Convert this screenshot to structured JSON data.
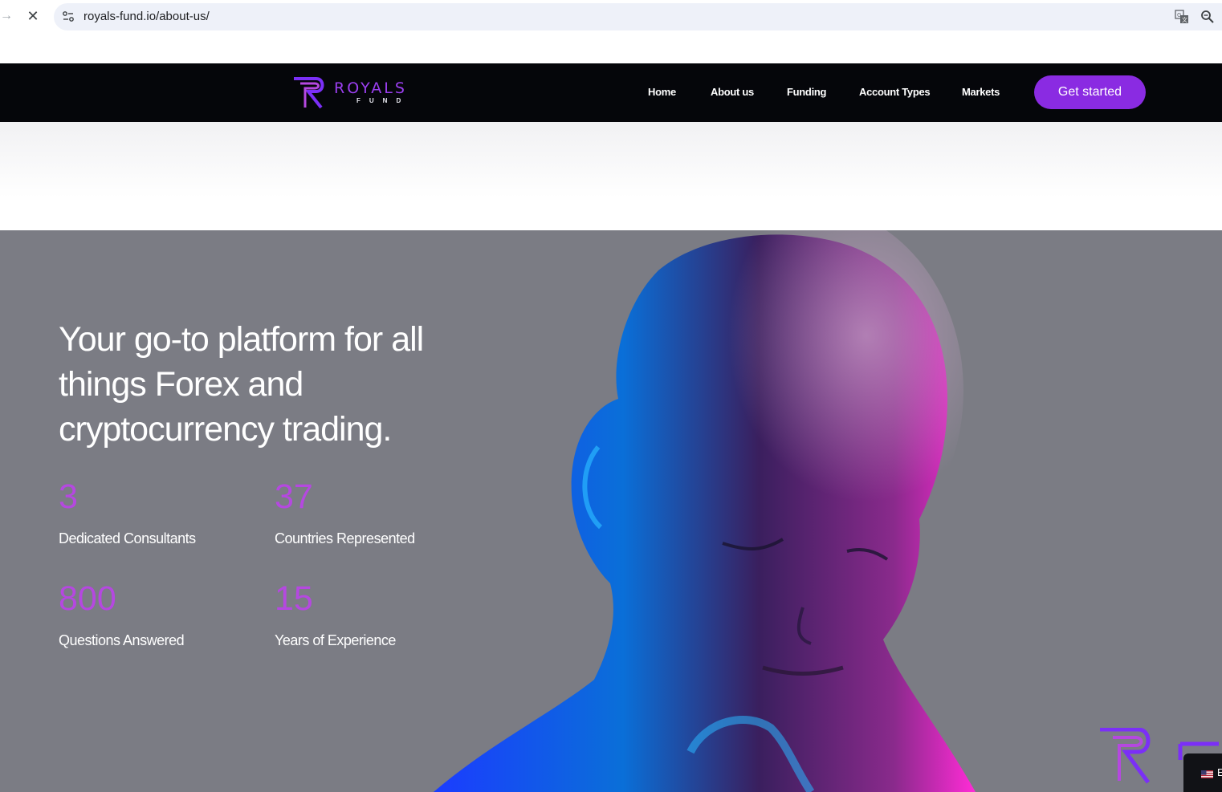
{
  "browser": {
    "url": "royals-fund.io/about-us/",
    "back_icon": "arrow-right-icon",
    "close_icon": "close-icon",
    "site_info_icon": "tune-icon",
    "translate_icon": "translate-icon",
    "zoom_icon": "zoom-icon",
    "close_glyph": "✕",
    "forward_glyph": "→"
  },
  "header": {
    "logo": {
      "word": "ROYALS",
      "sub": "FUND"
    },
    "menu": [
      {
        "label": "Home"
      },
      {
        "label": "About us"
      },
      {
        "label": "Funding"
      },
      {
        "label": "Account Types"
      },
      {
        "label": "Markets"
      }
    ],
    "cta_label": "Get started"
  },
  "hero": {
    "headline": "Your go-to platform for all things Forex and cryptocurrency trading.",
    "stats": [
      {
        "value": "3",
        "label": "Dedicated Consultants"
      },
      {
        "value": "37",
        "label": "Countries Represented"
      },
      {
        "value": "800",
        "label": "Questions Answered"
      },
      {
        "value": "15",
        "label": "Years of Experience"
      }
    ],
    "language_label": "E"
  },
  "colors": {
    "accent": "#8a2be2",
    "stat_number": "#b548e0",
    "header_bg": "#05060a",
    "hero_bg": "#7b7c84"
  }
}
